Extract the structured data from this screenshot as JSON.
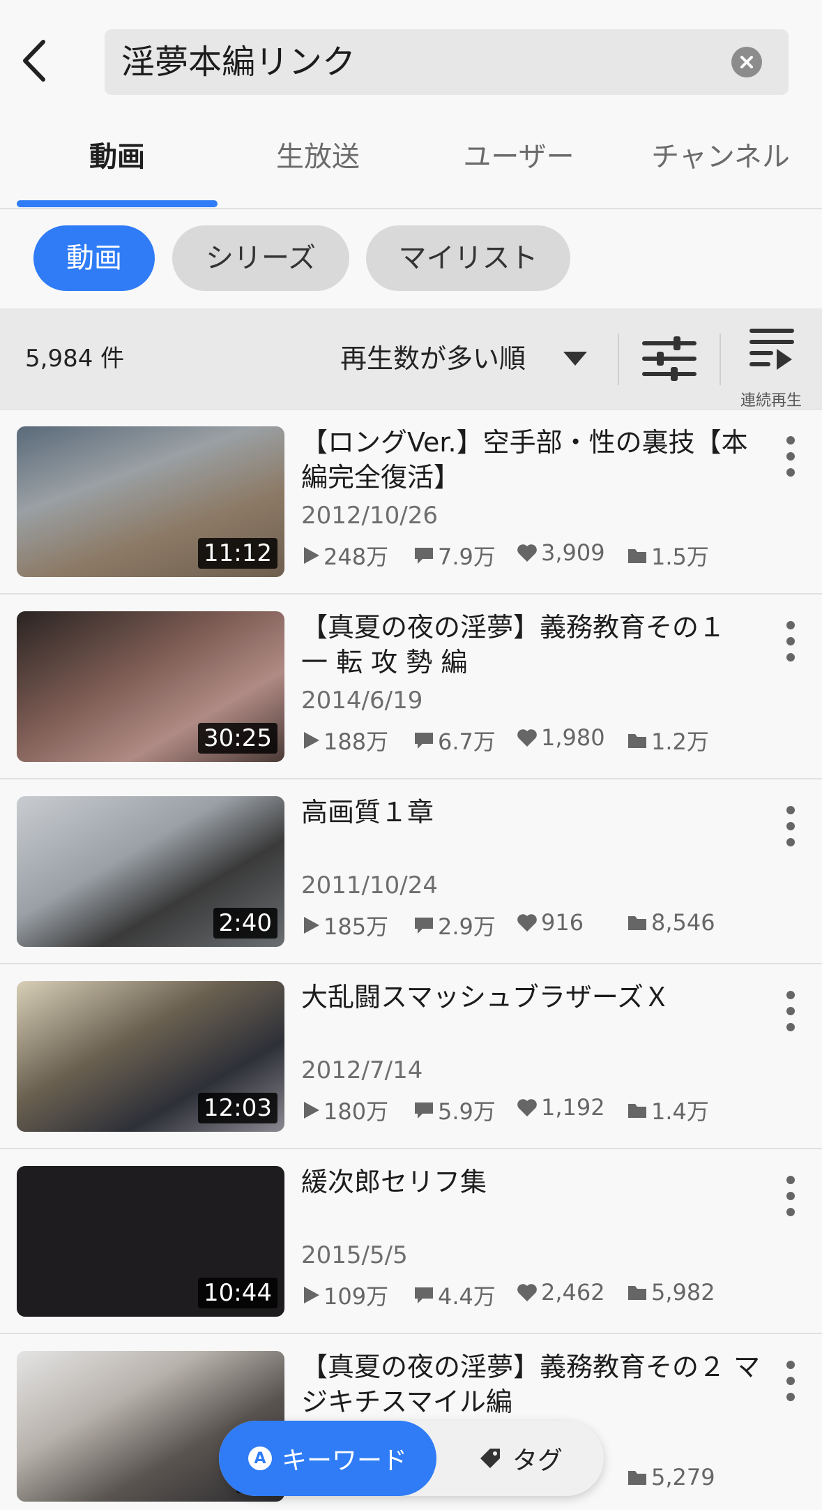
{
  "search": {
    "query": "淫夢本編リンク"
  },
  "tabs": [
    {
      "label": "動画"
    },
    {
      "label": "生放送"
    },
    {
      "label": "ユーザー"
    },
    {
      "label": "チャンネル"
    }
  ],
  "chips": [
    {
      "label": "動画"
    },
    {
      "label": "シリーズ"
    },
    {
      "label": "マイリスト"
    }
  ],
  "sortbar": {
    "count": "5,984 件",
    "sort_label": "再生数が多い順",
    "continuous_label": "連続再生"
  },
  "videos": [
    {
      "title": "【ロングVer.】空手部・性の裏技【本編完全復活】",
      "duration": "11:12",
      "date": "2012/10/26",
      "views": "248万",
      "comments": "7.9万",
      "likes": "3,909",
      "mylists": "1.5万"
    },
    {
      "title": "【真夏の夜の淫夢】義務教育その１　一 転 攻 勢 編",
      "duration": "30:25",
      "date": "2014/6/19",
      "views": "188万",
      "comments": "6.7万",
      "likes": "1,980",
      "mylists": "1.2万"
    },
    {
      "title": "高画質１章",
      "duration": "2:40",
      "date": "2011/10/24",
      "views": "185万",
      "comments": "2.9万",
      "likes": "916",
      "mylists": "8,546"
    },
    {
      "title": "大乱闘スマッシュブラザーズＸ",
      "duration": "12:03",
      "date": "2012/7/14",
      "views": "180万",
      "comments": "5.9万",
      "likes": "1,192",
      "mylists": "1.4万"
    },
    {
      "title": "緩次郎セリフ集",
      "duration": "10:44",
      "date": "2015/5/5",
      "views": "109万",
      "comments": "4.4万",
      "likes": "2,462",
      "mylists": "5,982"
    },
    {
      "title": "【真夏の夜の淫夢】義務教育その２ マジキチスマイル編",
      "duration": "34",
      "date": "",
      "views": "",
      "comments": "",
      "likes": "",
      "mylists": "5,279"
    }
  ],
  "float": {
    "keyword_label": "キーワード",
    "tag_label": "タグ"
  },
  "colors": {
    "accent": "#2f7cf6"
  }
}
